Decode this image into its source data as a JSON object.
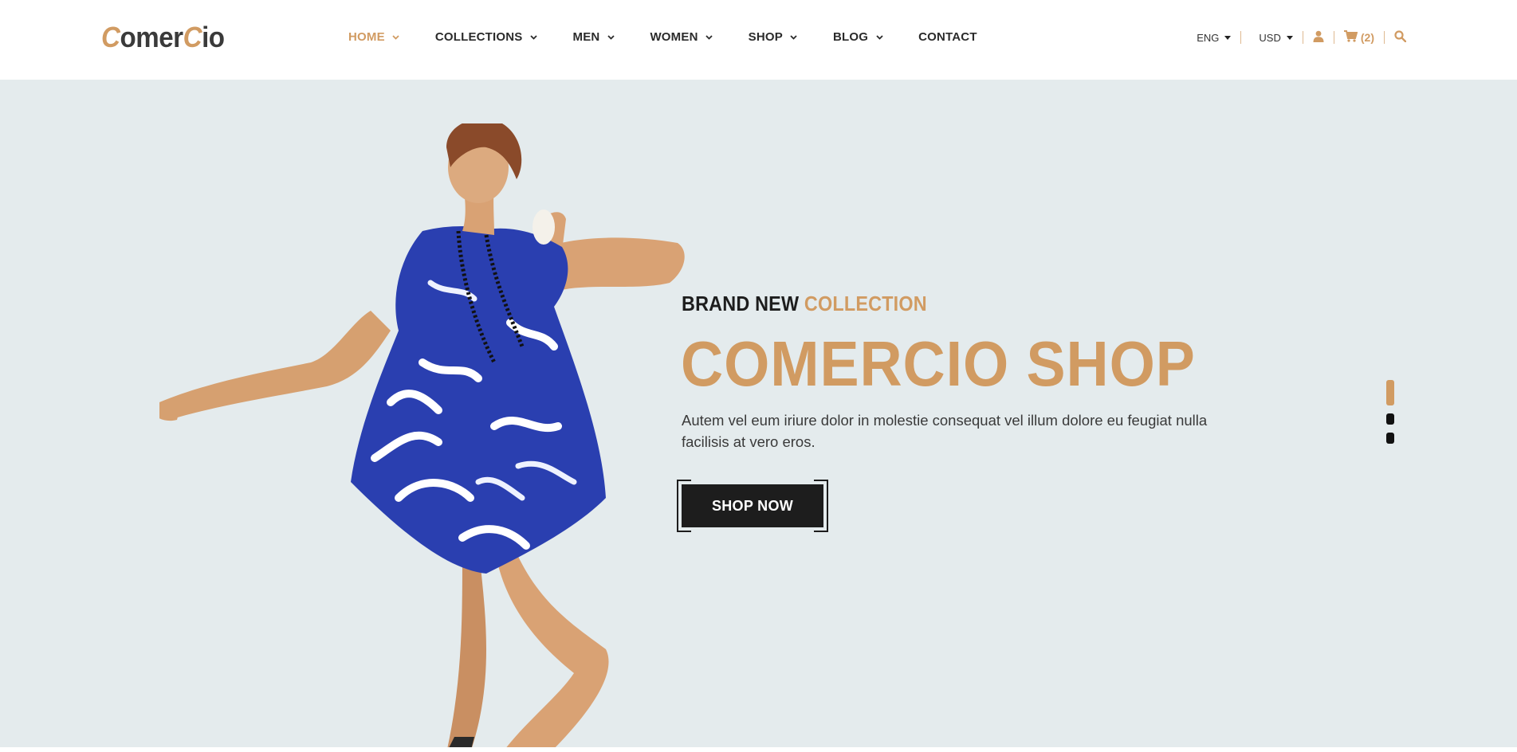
{
  "brand": {
    "logo_prefix_accent": "C",
    "logo_part1": "omer",
    "logo_accent2": "C",
    "logo_part2": "io"
  },
  "nav": {
    "items": [
      {
        "label": "HOME",
        "dropdown": true,
        "active": true
      },
      {
        "label": "COLLECTIONS",
        "dropdown": true,
        "active": false
      },
      {
        "label": "MEN",
        "dropdown": true,
        "active": false
      },
      {
        "label": "WOMEN",
        "dropdown": true,
        "active": false
      },
      {
        "label": "SHOP",
        "dropdown": true,
        "active": false
      },
      {
        "label": "BLOG",
        "dropdown": true,
        "active": false
      },
      {
        "label": "CONTACT",
        "dropdown": false,
        "active": false
      }
    ]
  },
  "utilities": {
    "language": "ENG",
    "currency": "USD",
    "account_icon": "user-icon",
    "cart_icon": "cart-icon",
    "cart_count": "(2)",
    "search_icon": "search-icon"
  },
  "hero": {
    "subtitle_main": "BRAND NEW",
    "subtitle_accent": "COLLECTION",
    "headline": "COMERCIO SHOP",
    "description": "Autem vel eum iriure dolor in molestie consequat vel illum dolore eu feugiat nulla facilisis at vero eros.",
    "cta_label": "SHOP NOW",
    "slides": 3,
    "active_slide": 1
  },
  "colors": {
    "accent": "#d19b62",
    "dark": "#1d1d1d",
    "hero_bg": "#e4ebed",
    "dress_blue": "#2a3fb0"
  }
}
